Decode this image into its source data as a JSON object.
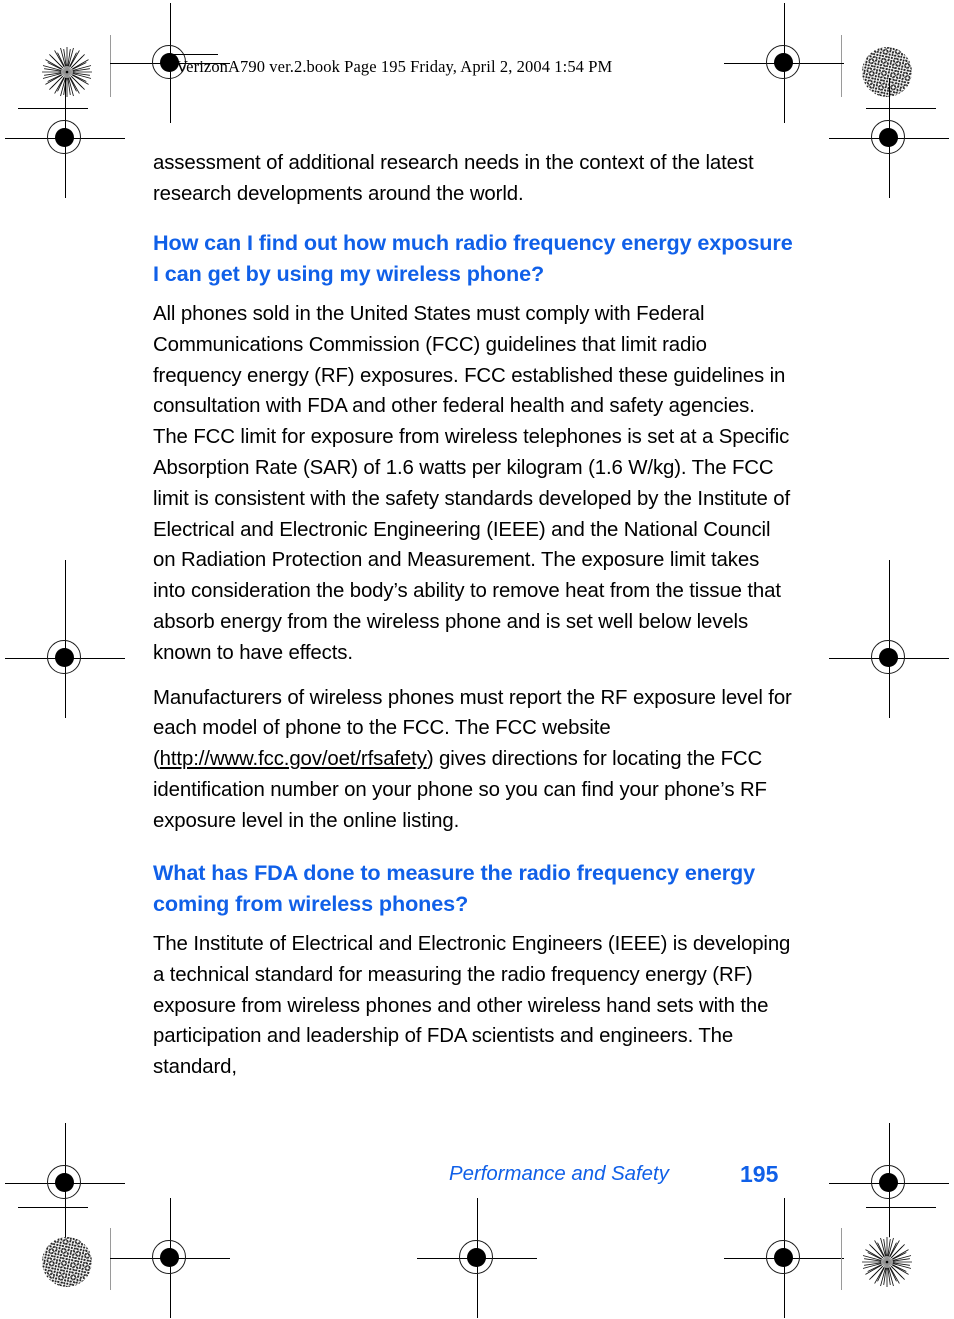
{
  "page": {
    "header_line": "VerizonA790 ver.2.book  Page 195  Friday, April 2, 2004  1:54 PM",
    "accent_color": "#1060E8",
    "text_color": "#000000",
    "background_color": "#FFFFFF",
    "page_number": "195"
  },
  "content": {
    "continued_paragraph": "assessment of additional research needs in the context of the latest research developments around the world.",
    "heading_1": "How can I find out how much radio frequency energy exposure I can get by using my wireless phone?",
    "paragraph_1": "All phones sold in the United States must comply with Federal Communications Commission (FCC) guidelines that limit radio frequency energy (RF) exposures. FCC established these guidelines in consultation with FDA and other federal health and safety agencies. The FCC limit for exposure from wireless telephones is set at a Specific Absorption Rate (SAR) of 1.6 watts per kilogram (1.6 W/kg). The FCC limit is consistent with the safety standards developed by the Institute of Electrical and Electronic Engineering (IEEE) and the National Council on Radiation Protection and Measurement. The exposure limit takes into consideration the body’s ability to remove heat from the tissue that absorb energy from the wireless phone and is set well below levels known to have effects.",
    "paragraph_2_before_link": "Manufacturers of wireless phones must report the RF exposure level for each model of phone to the FCC. The FCC website (",
    "paragraph_2_link": "http://www.fcc.gov/oet/rfsafety",
    "paragraph_2_after_link": ") gives directions for locating the FCC identification number on your phone so you can find your phone’s RF exposure level in the online listing.",
    "heading_2": "What has FDA done to measure the radio frequency energy coming from wireless phones?",
    "paragraph_3": "The Institute of Electrical and Electronic Engineers (IEEE) is developing a technical standard for measuring the radio frequency energy (RF) exposure from wireless phones and other wireless hand sets with the participation and leadership of FDA scientists and engineers. The standard,"
  },
  "footer": {
    "chapter_title": "Performance and Safety",
    "page_number": "195"
  },
  "print_marks": {
    "registration_target_name": "registration-crosshair-target",
    "starburst_target_name": "starburst-resolution-target",
    "moire_target_name": "moire-halftone-target"
  }
}
